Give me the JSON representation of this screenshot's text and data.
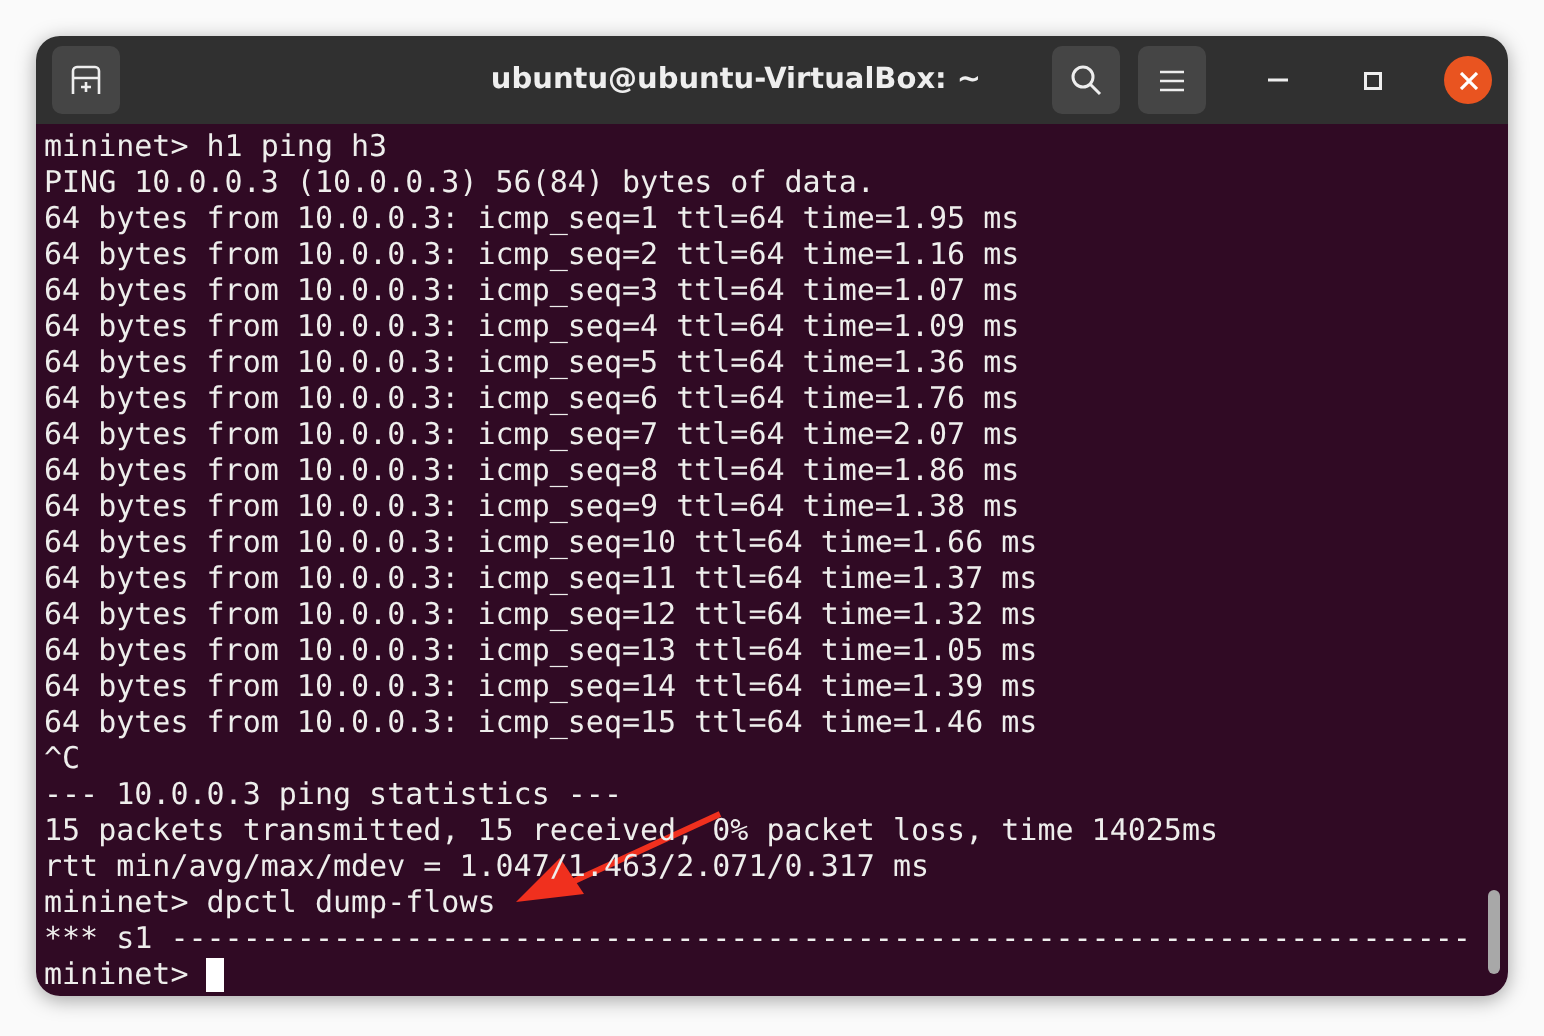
{
  "window": {
    "title": "ubuntu@ubuntu-VirtualBox: ~"
  },
  "terminal": {
    "lines": [
      "mininet> h1 ping h3",
      "PING 10.0.0.3 (10.0.0.3) 56(84) bytes of data.",
      "64 bytes from 10.0.0.3: icmp_seq=1 ttl=64 time=1.95 ms",
      "64 bytes from 10.0.0.3: icmp_seq=2 ttl=64 time=1.16 ms",
      "64 bytes from 10.0.0.3: icmp_seq=3 ttl=64 time=1.07 ms",
      "64 bytes from 10.0.0.3: icmp_seq=4 ttl=64 time=1.09 ms",
      "64 bytes from 10.0.0.3: icmp_seq=5 ttl=64 time=1.36 ms",
      "64 bytes from 10.0.0.3: icmp_seq=6 ttl=64 time=1.76 ms",
      "64 bytes from 10.0.0.3: icmp_seq=7 ttl=64 time=2.07 ms",
      "64 bytes from 10.0.0.3: icmp_seq=8 ttl=64 time=1.86 ms",
      "64 bytes from 10.0.0.3: icmp_seq=9 ttl=64 time=1.38 ms",
      "64 bytes from 10.0.0.3: icmp_seq=10 ttl=64 time=1.66 ms",
      "64 bytes from 10.0.0.3: icmp_seq=11 ttl=64 time=1.37 ms",
      "64 bytes from 10.0.0.3: icmp_seq=12 ttl=64 time=1.32 ms",
      "64 bytes from 10.0.0.3: icmp_seq=13 ttl=64 time=1.05 ms",
      "64 bytes from 10.0.0.3: icmp_seq=14 ttl=64 time=1.39 ms",
      "64 bytes from 10.0.0.3: icmp_seq=15 ttl=64 time=1.46 ms",
      "^C",
      "--- 10.0.0.3 ping statistics ---",
      "15 packets transmitted, 15 received, 0% packet loss, time 14025ms",
      "rtt min/avg/max/mdev = 1.047/1.463/2.071/0.317 ms",
      "mininet> dpctl dump-flows",
      "*** s1 ------------------------------------------------------------------------"
    ],
    "prompt": "mininet>"
  }
}
